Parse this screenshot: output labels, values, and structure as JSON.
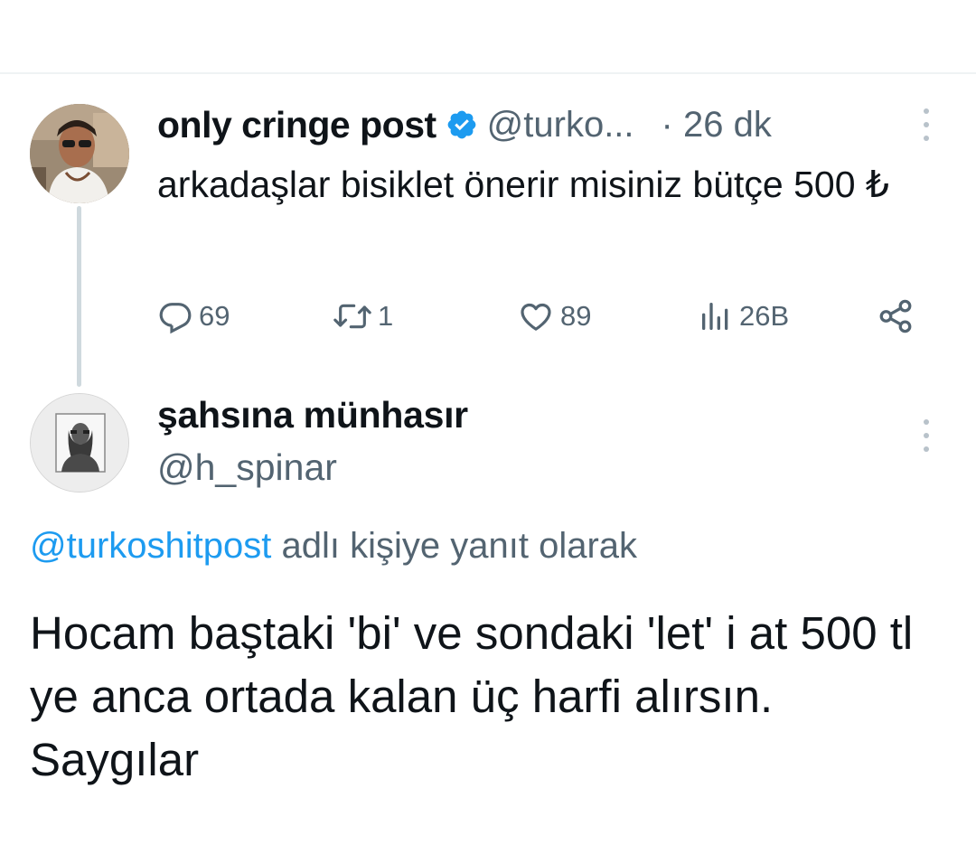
{
  "tweet1": {
    "display_name": "only cringe post",
    "handle": "@turko...",
    "time": "· 26 dk",
    "text": "arkadaşlar bisiklet önerir misiniz bütçe 500 ₺",
    "actions": {
      "reply_count": "69",
      "retweet_count": "1",
      "like_count": "89",
      "views_count": "26B"
    }
  },
  "tweet2": {
    "display_name": "şahsına münhasır",
    "handle": "@h_spinar",
    "reply_to_mention": "@turkoshitpost",
    "reply_to_suffix": " adlı kişiye yanıt olarak",
    "text": "Hocam baştaki 'bi' ve sondaki 'let' i at 500 tl ye anca ortada kalan üç harfi alırsın. Saygılar"
  },
  "colors": {
    "text_primary": "#0f1419",
    "text_secondary": "#536471",
    "accent": "#1d9bf0",
    "thread_line": "#cfd9de"
  },
  "icons": {
    "verified": "verified-badge-icon",
    "reply": "reply-icon",
    "retweet": "retweet-icon",
    "like": "heart-icon",
    "views": "views-chart-icon",
    "share": "share-icon",
    "more": "more-options-icon"
  }
}
